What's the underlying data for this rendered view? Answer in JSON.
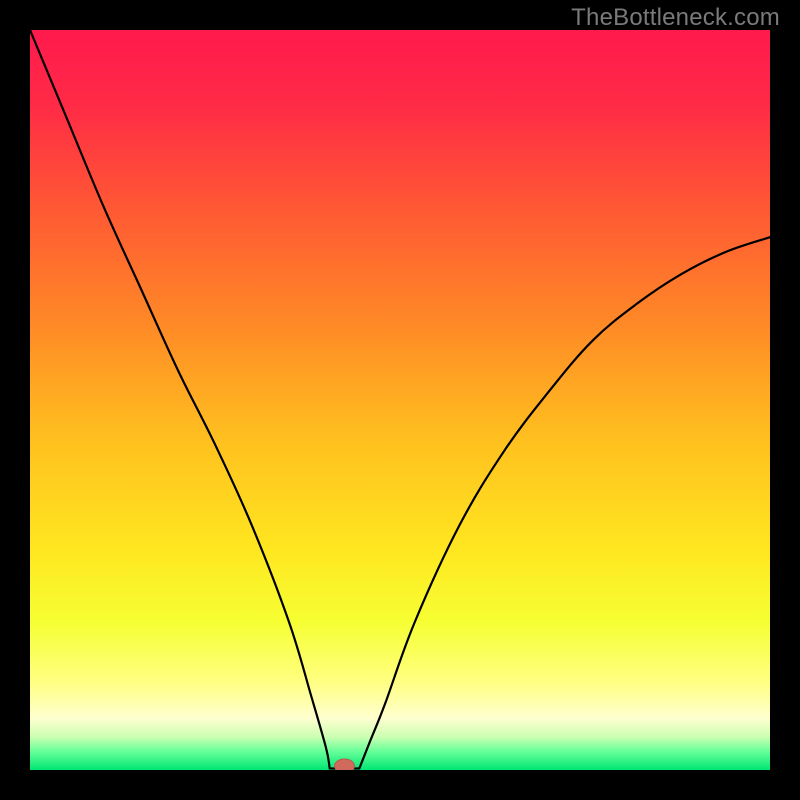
{
  "watermark": "TheBottleneck.com",
  "colors": {
    "frame": "#000000",
    "gradient_stops": [
      {
        "offset": 0.0,
        "color": "#ff1a4d"
      },
      {
        "offset": 0.1,
        "color": "#ff2a46"
      },
      {
        "offset": 0.25,
        "color": "#ff5b33"
      },
      {
        "offset": 0.4,
        "color": "#ff8a26"
      },
      {
        "offset": 0.55,
        "color": "#ffbf1f"
      },
      {
        "offset": 0.7,
        "color": "#ffe61f"
      },
      {
        "offset": 0.8,
        "color": "#f6ff33"
      },
      {
        "offset": 0.88,
        "color": "#ffff80"
      },
      {
        "offset": 0.93,
        "color": "#ffffd0"
      },
      {
        "offset": 0.955,
        "color": "#ccffb3"
      },
      {
        "offset": 0.975,
        "color": "#66ff99"
      },
      {
        "offset": 1.0,
        "color": "#00e673"
      }
    ],
    "curve": "#000000",
    "marker_fill": "#d06a5c",
    "marker_stroke": "#b85a50"
  },
  "chart_data": {
    "type": "line",
    "title": "",
    "xlabel": "",
    "ylabel": "",
    "xlim": [
      0,
      100
    ],
    "ylim": [
      0,
      100
    ],
    "series": [
      {
        "name": "bottleneck-curve",
        "x": [
          0,
          5,
          10,
          15,
          20,
          25,
          30,
          35,
          38,
          40,
          41,
          42,
          43,
          44,
          46,
          48,
          52,
          58,
          64,
          70,
          76,
          82,
          88,
          94,
          100
        ],
        "y": [
          100,
          88,
          76,
          65,
          54,
          44,
          33,
          20,
          10,
          3,
          1,
          0,
          0,
          1,
          4,
          9,
          20,
          33,
          43,
          51,
          58,
          63,
          67,
          70,
          72
        ]
      }
    ],
    "marker": {
      "x": 42.5,
      "y": 0
    },
    "flat_segment": {
      "x0": 40.5,
      "x1": 44.5,
      "y": 0.2
    }
  }
}
